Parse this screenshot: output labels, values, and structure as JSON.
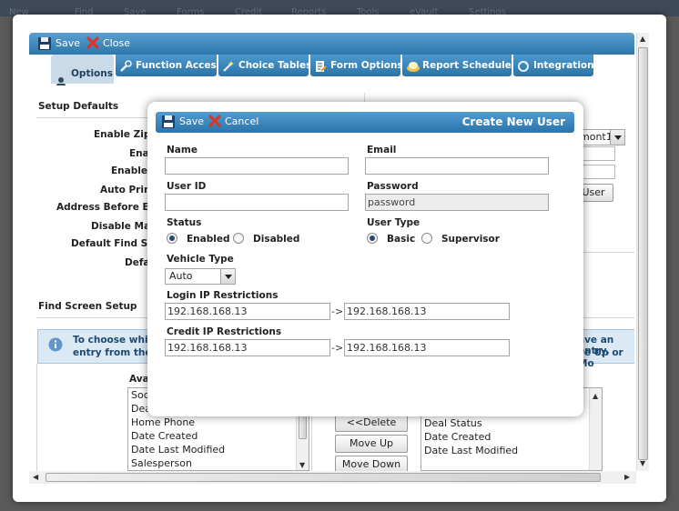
{
  "topbar": {
    "items": [
      "New",
      "Find",
      "Save",
      "Forms",
      "Credit",
      "Reports",
      "Tools",
      "eVault",
      "Settings"
    ]
  },
  "outer": {
    "save_label": "Save",
    "close_label": "Close",
    "tabs": [
      "Options",
      "Function Access",
      "Choice Tables",
      "Form Options",
      "Report Scheduler",
      "Integration"
    ],
    "setup_defaults": "Setup Defaults",
    "fields": [
      "Enable Zip E",
      "Enab",
      "Enable A",
      "Auto Print",
      "Address Before Emp",
      "Disable Mai",
      "Default Find Scre",
      "Defa"
    ],
    "right_select_value": "mont1",
    "user_button": "User",
    "find_screen_setup": "Find Screen Setup",
    "info_left_line1": "To choose which",
    "info_left_line2": "entry from the li",
    "info_right_line1": "ave an entry,",
    "info_right_line2": "ve Up or Mo",
    "available_label": "Ava",
    "available_items": [
      "Soc",
      "Dea",
      "Home Phone",
      "Date Created",
      "Date Last Modified",
      "Salesperson"
    ],
    "delete_button": "<<Delete",
    "move_up_button": "Move Up",
    "move_down_button": "Move Down",
    "selected_items": [
      "Deal Status",
      "Date Created",
      "Date Last Modified"
    ]
  },
  "modal": {
    "title": "Create New User",
    "save_label": "Save",
    "cancel_label": "Cancel",
    "name_label": "Name",
    "name_value": "",
    "email_label": "Email",
    "email_value": "",
    "userid_label": "User ID",
    "userid_value": "",
    "password_label": "Password",
    "password_value": "password",
    "status_label": "Status",
    "status_enabled": "Enabled",
    "status_disabled": "Disabled",
    "usertype_label": "User Type",
    "usertype_basic": "Basic",
    "usertype_supervisor": "Supervisor",
    "vehicle_label": "Vehicle Type",
    "vehicle_value": "Auto",
    "login_ip_label": "Login IP Restrictions",
    "login_ip_from": "192.168.168.13",
    "login_ip_to": "192.168.168.13",
    "credit_ip_label": "Credit IP Restrictions",
    "credit_ip_from": "192.168.168.13",
    "credit_ip_to": "192.168.168.13",
    "range_arrow": "->"
  },
  "colors": {
    "header_blue": "#2c77ad",
    "tab_active": "#c9dbe9",
    "info_bg": "#dbe9f5"
  }
}
